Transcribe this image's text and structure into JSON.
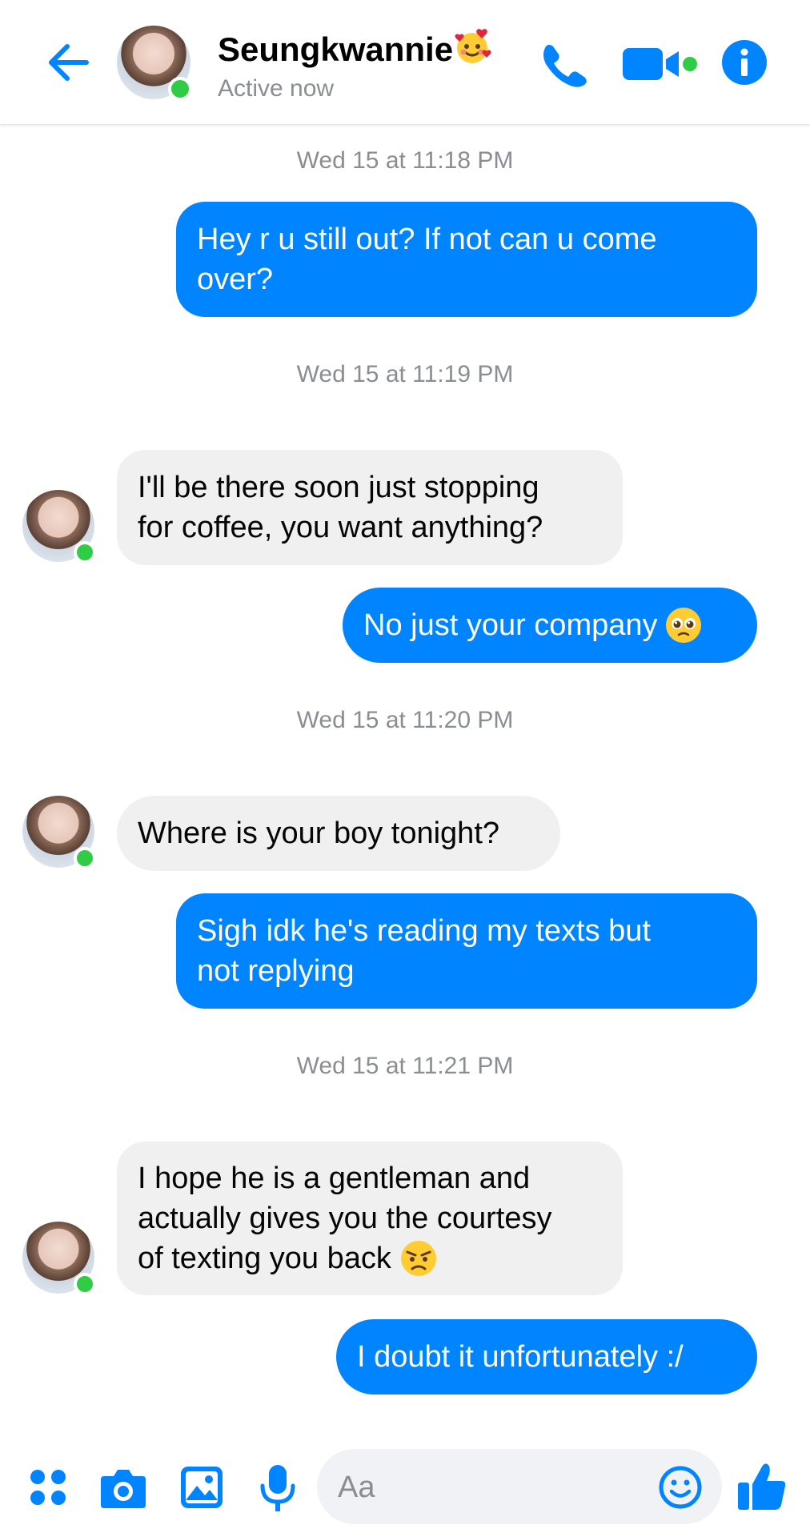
{
  "header": {
    "contact_name": "Seungkwannie",
    "status": "Active now"
  },
  "colors": {
    "accent": "#0084ff",
    "online": "#31cc46",
    "incoming_bubble": "#f0f0f0",
    "meta_text": "#8a8d91"
  },
  "messages": {
    "ts1": "Wed 15 at 11:18 PM",
    "m1_l1": "Hey r u still out? If not can u come",
    "m1_l2": "over?",
    "ts2": "Wed 15 at 11:19 PM",
    "m2_l1": "I'll be there soon just stopping",
    "m2_l2": "for coffee, you want anything?",
    "m3": "No just your company",
    "ts3": "Wed 15 at 11:20 PM",
    "m4": "Where is your boy tonight?",
    "m5_l1": "Sigh idk he's reading my texts but",
    "m5_l2": "not replying",
    "ts4": "Wed 15 at 11:21 PM",
    "m6_l1": "I hope he is a gentleman and",
    "m6_l2": "actually gives you the courtesy",
    "m6_l3": "of texting you back",
    "m7": "I doubt it unfortunately :/"
  },
  "composer": {
    "placeholder": "Aa"
  },
  "icons": {
    "back": "back-arrow-icon",
    "call": "phone-icon",
    "video": "video-camera-icon",
    "info": "info-icon",
    "apps": "apps-grid-icon",
    "camera": "camera-icon",
    "gallery": "gallery-icon",
    "mic": "microphone-icon",
    "emoji": "emoji-icon",
    "like": "thumbs-up-icon"
  }
}
